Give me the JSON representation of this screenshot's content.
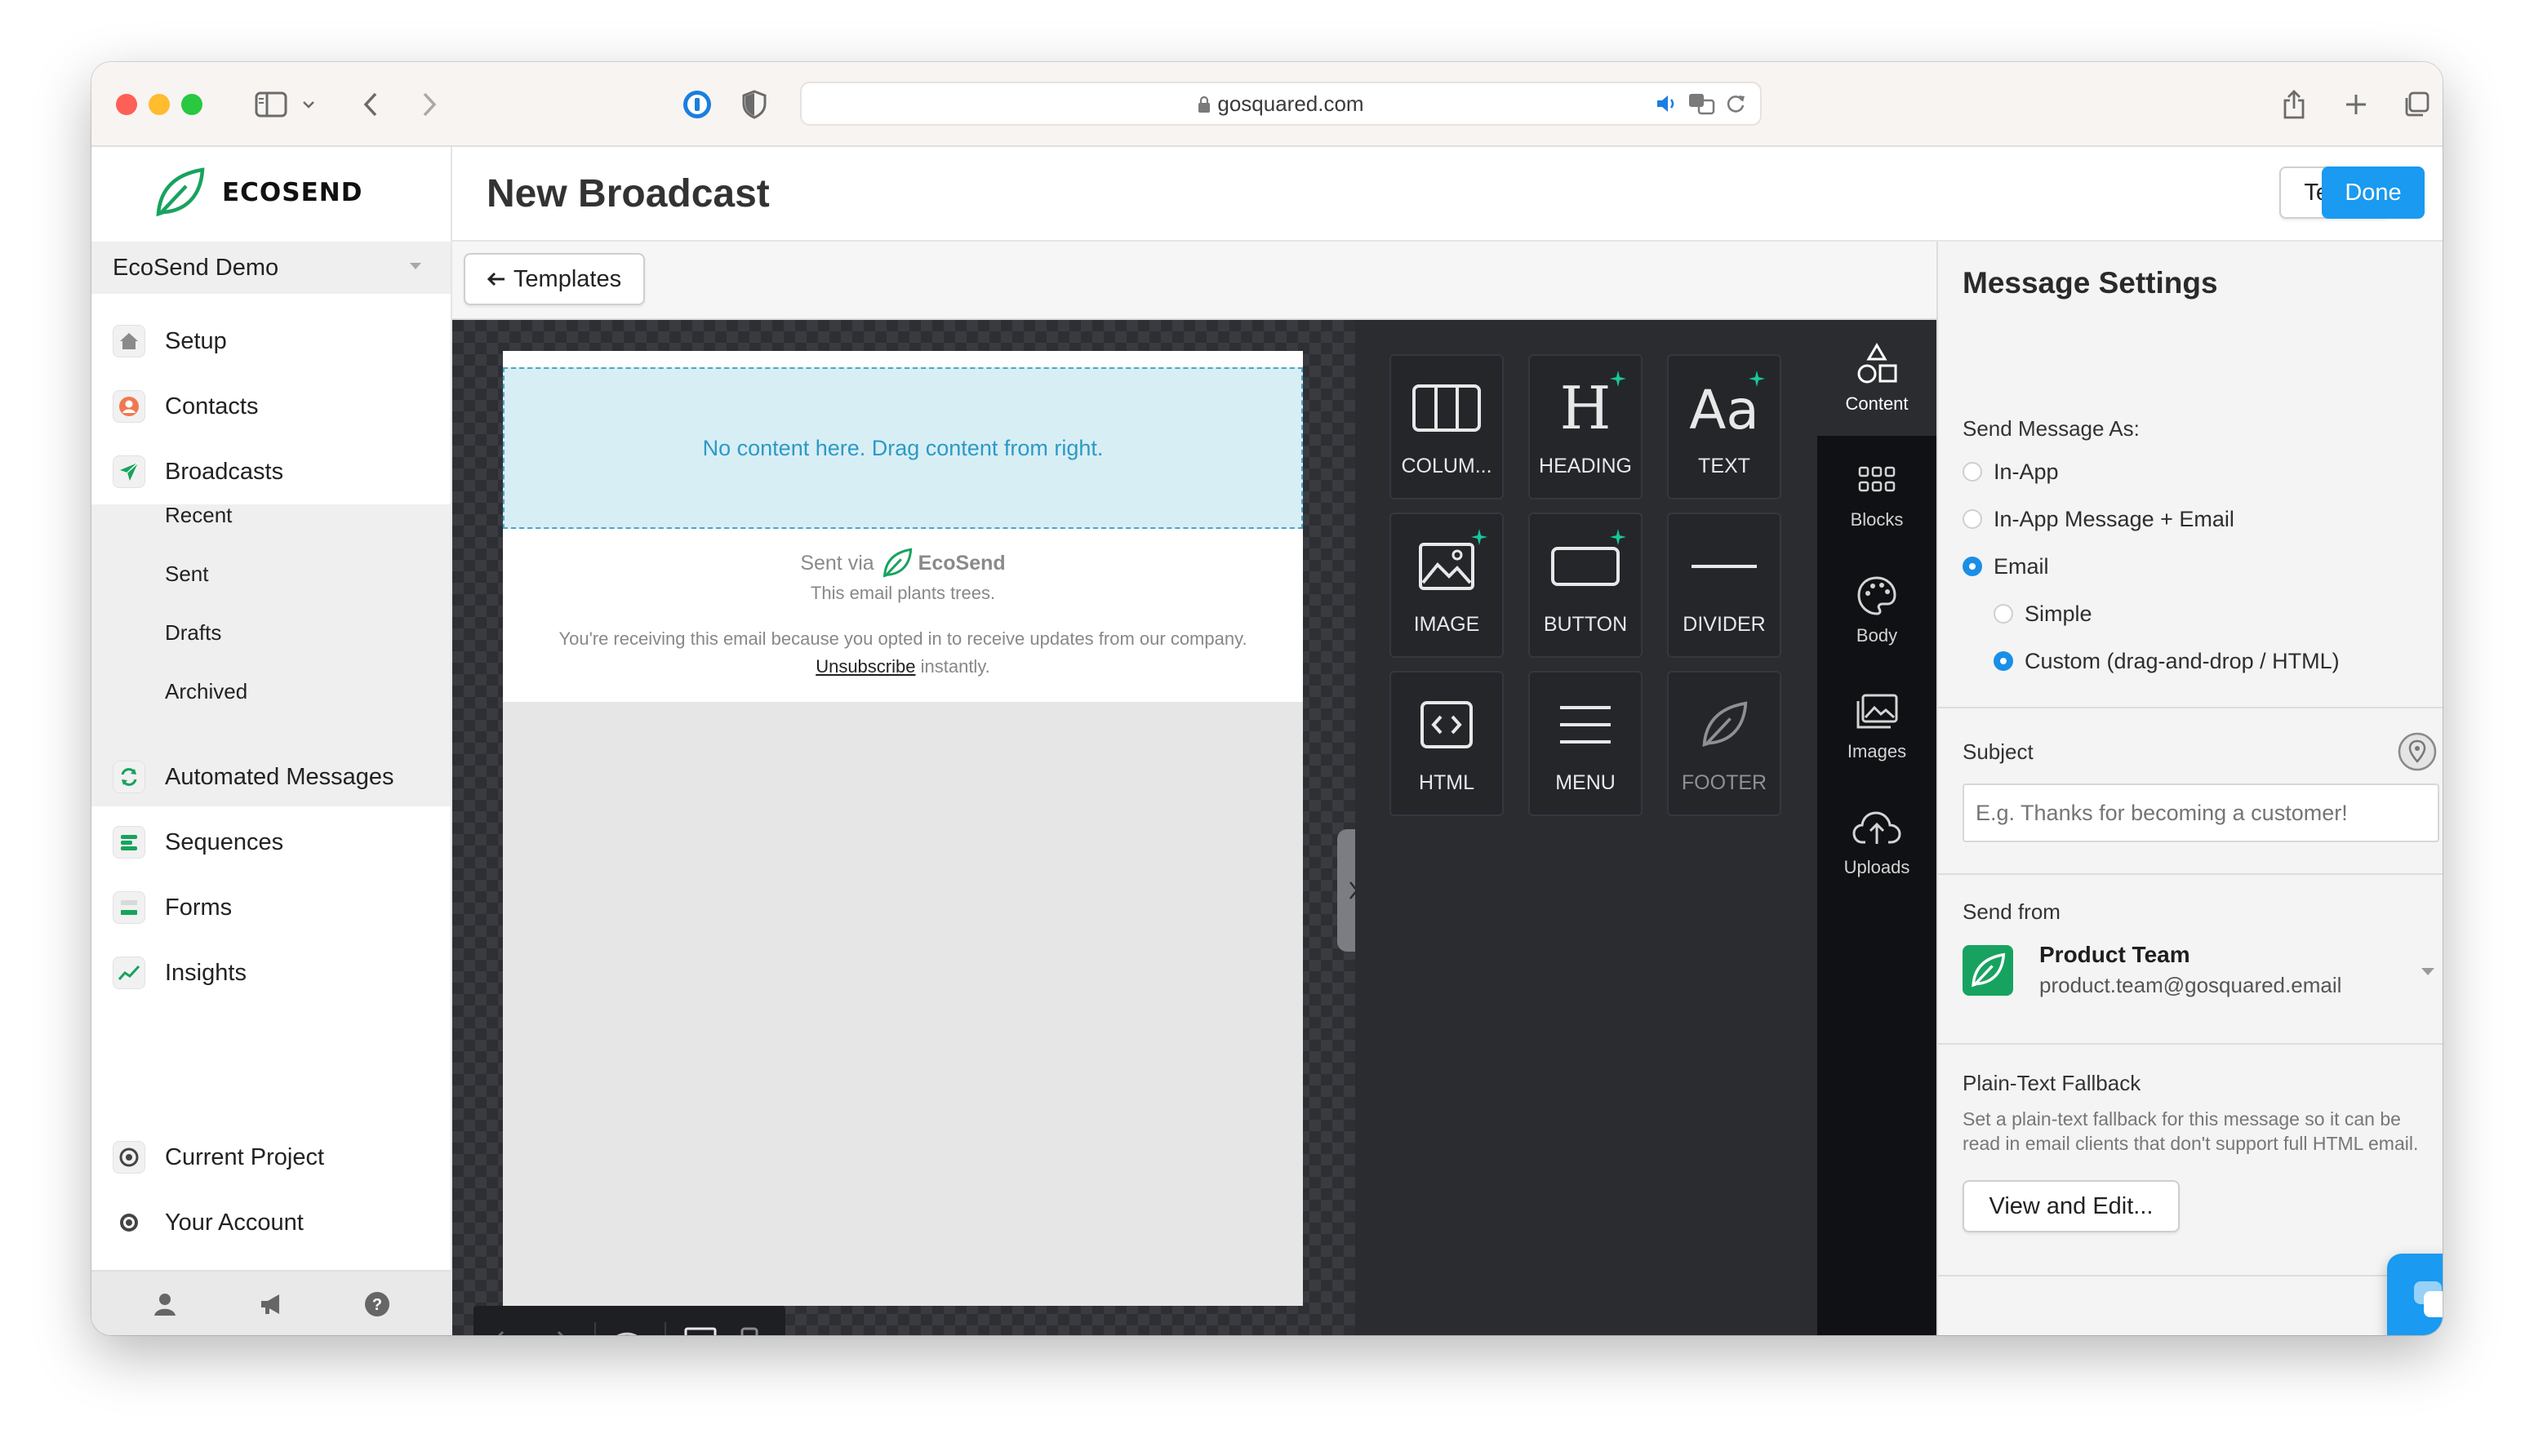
{
  "browser": {
    "url": "gosquared.com"
  },
  "brand": {
    "name": "ECOSEND",
    "green": "#17a35f",
    "accent": "#1a9af0"
  },
  "sidebar": {
    "project": "EcoSend Demo",
    "items": [
      {
        "label": "Setup",
        "icon": "house-icon"
      },
      {
        "label": "Contacts",
        "icon": "person-icon"
      },
      {
        "label": "Broadcasts",
        "icon": "paper-plane-icon"
      },
      {
        "label": "Automated Messages",
        "icon": "refresh-icon"
      },
      {
        "label": "Sequences",
        "icon": "sequence-icon"
      },
      {
        "label": "Forms",
        "icon": "form-icon"
      },
      {
        "label": "Insights",
        "icon": "chart-line-icon"
      }
    ],
    "broadcast_sub": [
      "Recent",
      "Sent",
      "Drafts",
      "Archived"
    ],
    "bottom_items": [
      {
        "label": "Current Project",
        "icon": "project-icon"
      },
      {
        "label": "Your Account",
        "icon": "gear-icon"
      }
    ]
  },
  "header": {
    "title": "New Broadcast",
    "test_label": "Test...",
    "done_label": "Done"
  },
  "editor": {
    "templates_label": "Templates",
    "dropzone_text": "No content here. Drag content from right.",
    "sent_via": "Sent via",
    "sent_via_brand": "EcoSend",
    "plants_trees": "This email plants trees.",
    "receiving_text": "You're receiving this email because you opted in to receive updates from our company.",
    "unsubscribe": "Unsubscribe",
    "instantly": "instantly."
  },
  "content_tiles": [
    "COLUM...",
    "HEADING",
    "TEXT",
    "IMAGE",
    "BUTTON",
    "DIVIDER",
    "HTML",
    "MENU",
    "FOOTER"
  ],
  "side_tabs": [
    "Content",
    "Blocks",
    "Body",
    "Images",
    "Uploads"
  ],
  "settings": {
    "title": "Message Settings",
    "send_as_label": "Send Message As:",
    "options": [
      "In-App",
      "In-App Message + Email",
      "Email",
      "Simple",
      "Custom (drag-and-drop / HTML)"
    ],
    "subject_label": "Subject",
    "subject_placeholder": "E.g. Thanks for becoming a customer!",
    "send_from_label": "Send from",
    "from_name": "Product Team",
    "from_email": "product.team@gosquared.email",
    "fallback_label": "Plain-Text Fallback",
    "fallback_desc": "Set a plain-text fallback for this message so it can be read in email clients that don't support full HTML email.",
    "view_edit_label": "View and Edit..."
  }
}
